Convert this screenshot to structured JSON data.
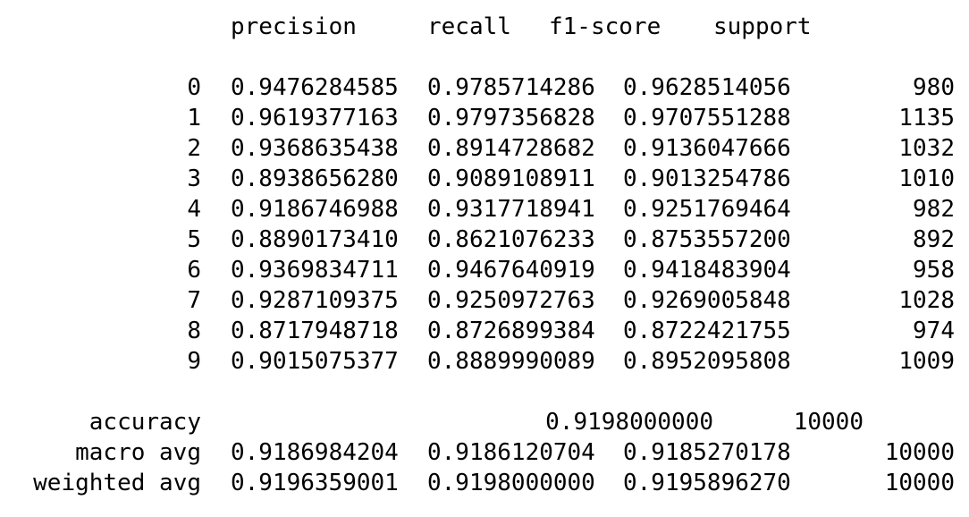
{
  "headers": {
    "precision": "precision",
    "recall": "recall",
    "f1": "f1-score",
    "support": "support"
  },
  "rows": [
    {
      "label": "0",
      "precision": "0.9476284585",
      "recall": "0.9785714286",
      "f1": "0.9628514056",
      "support": "980"
    },
    {
      "label": "1",
      "precision": "0.9619377163",
      "recall": "0.9797356828",
      "f1": "0.9707551288",
      "support": "1135"
    },
    {
      "label": "2",
      "precision": "0.9368635438",
      "recall": "0.8914728682",
      "f1": "0.9136047666",
      "support": "1032"
    },
    {
      "label": "3",
      "precision": "0.8938656280",
      "recall": "0.9089108911",
      "f1": "0.9013254786",
      "support": "1010"
    },
    {
      "label": "4",
      "precision": "0.9186746988",
      "recall": "0.9317718941",
      "f1": "0.9251769464",
      "support": "982"
    },
    {
      "label": "5",
      "precision": "0.8890173410",
      "recall": "0.8621076233",
      "f1": "0.8753557200",
      "support": "892"
    },
    {
      "label": "6",
      "precision": "0.9369834711",
      "recall": "0.9467640919",
      "f1": "0.9418483904",
      "support": "958"
    },
    {
      "label": "7",
      "precision": "0.9287109375",
      "recall": "0.9250972763",
      "f1": "0.9269005848",
      "support": "1028"
    },
    {
      "label": "8",
      "precision": "0.8717948718",
      "recall": "0.8726899384",
      "f1": "0.8722421755",
      "support": "974"
    },
    {
      "label": "9",
      "precision": "0.9015075377",
      "recall": "0.8889990089",
      "f1": "0.8952095808",
      "support": "1009"
    }
  ],
  "accuracy": {
    "label": "accuracy",
    "value": "0.9198000000",
    "support": "10000"
  },
  "macro_avg": {
    "label": "macro avg",
    "precision": "0.9186984204",
    "recall": "0.9186120704",
    "f1": "0.9185270178",
    "support": "10000"
  },
  "weighted_avg": {
    "label": "weighted avg",
    "precision": "0.9196359001",
    "recall": "0.9198000000",
    "f1": "0.9195896270",
    "support": "10000"
  }
}
